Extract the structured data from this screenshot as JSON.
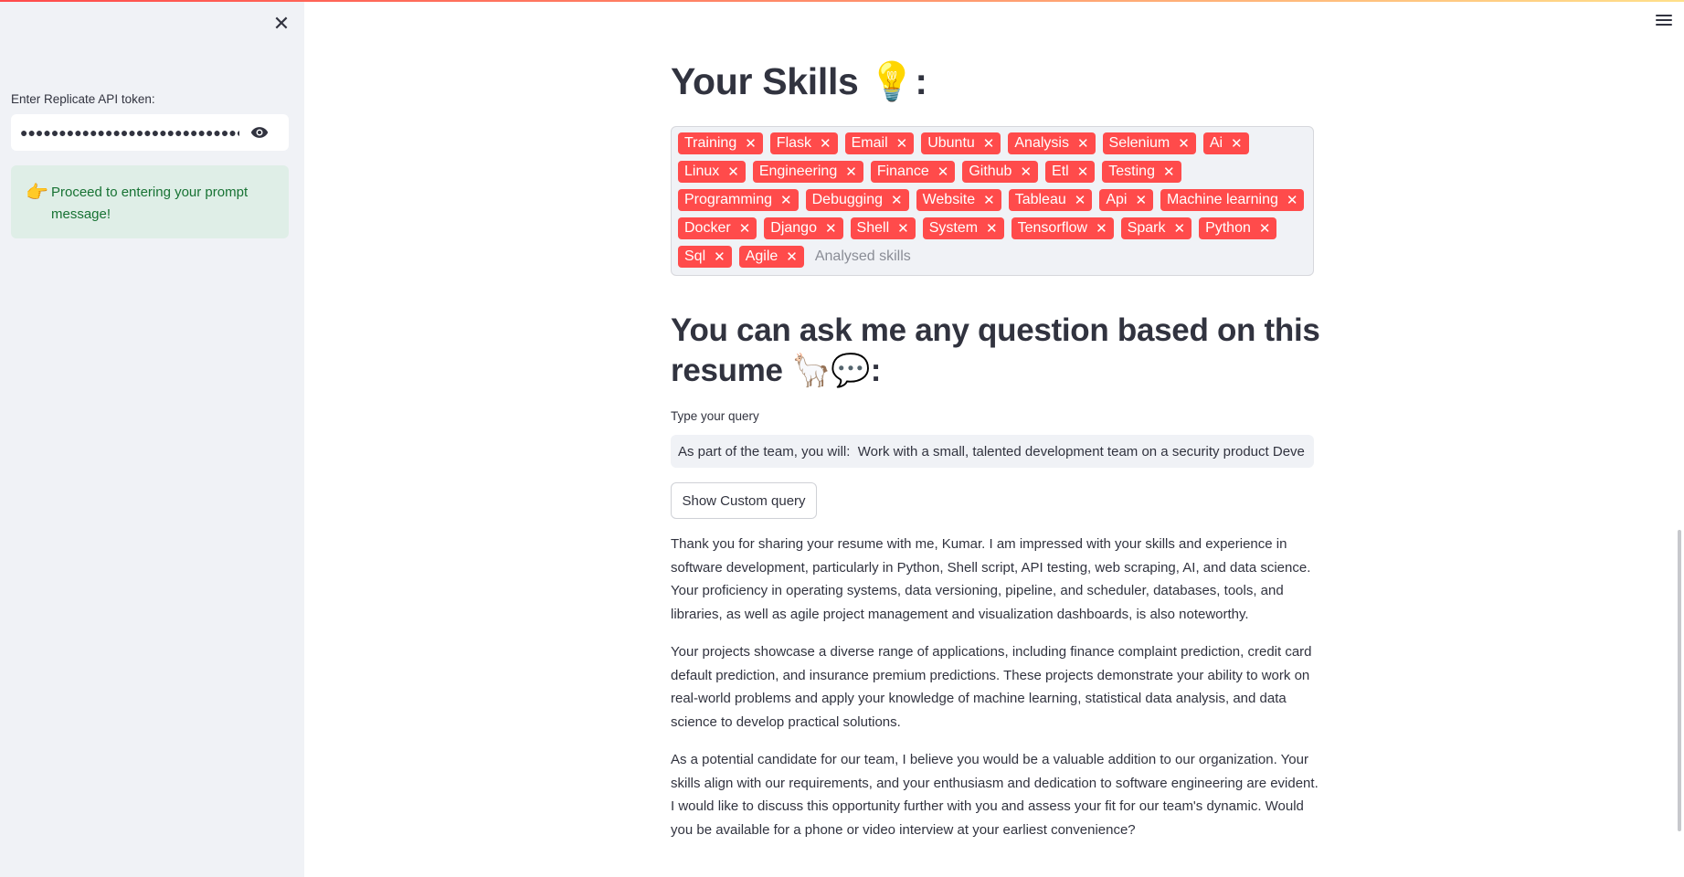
{
  "sidebar": {
    "close_glyph": "✕",
    "token_label": "Enter Replicate API token:",
    "token_value": "●●●●●●●●●●●●●●●●●●●●●●●●●●●●●●●●●●●●●●●●",
    "info_emoji": "👉",
    "info_text": "Proceed to entering your prompt message!"
  },
  "skills": {
    "heading": "Your Skills 💡:",
    "chips": [
      "Training",
      "Flask",
      "Email",
      "Ubuntu",
      "Analysis",
      "Selenium",
      "Ai",
      "Linux",
      "Engineering",
      "Finance",
      "Github",
      "Etl",
      "Testing",
      "Programming",
      "Debugging",
      "Website",
      "Tableau",
      "Api",
      "Machine learning",
      "Docker",
      "Django",
      "Shell",
      "System",
      "Tensorflow",
      "Spark",
      "Python",
      "Sql",
      "Agile"
    ],
    "remove_glyph": "✕",
    "placeholder": "Analysed skills"
  },
  "query": {
    "heading": "You can ask me any question based on this resume 🦙💬:",
    "label": "Type your query",
    "value": "As part of the team, you will:  Work with a small, talented development team on a security product Deve",
    "button_label": "Show Custom query"
  },
  "answer": {
    "paragraphs": [
      "Thank you for sharing your resume with me, Kumar. I am impressed with your skills and experience in software development, particularly in Python, Shell script, API testing, web scraping, AI, and data science. Your proficiency in operating systems, data versioning, pipeline, and scheduler, databases, tools, and libraries, as well as agile project management and visualization dashboards, is also noteworthy.",
      "Your projects showcase a diverse range of applications, including finance complaint prediction, credit card default prediction, and insurance premium predictions. These projects demonstrate your ability to work on real-world problems and apply your knowledge of machine learning, statistical data analysis, and data science to develop practical solutions.",
      "As a potential candidate for our team, I believe you would be a valuable addition to our organization. Your skills align with our requirements, and your enthusiasm and dedication to software engineering are evident. I would like to discuss this opportunity further with you and assess your fit for our team's dynamic. Would you be available for a phone or video interview at your earliest convenience?"
    ]
  },
  "colors": {
    "chip": "#ff4b4b",
    "sidebar_bg": "#f0f2f6",
    "info_bg": "#dfeee7",
    "info_text": "#177233"
  },
  "icons": {
    "close": "close-icon",
    "eye": "eye-icon",
    "menu": "hamburger-menu-icon"
  }
}
